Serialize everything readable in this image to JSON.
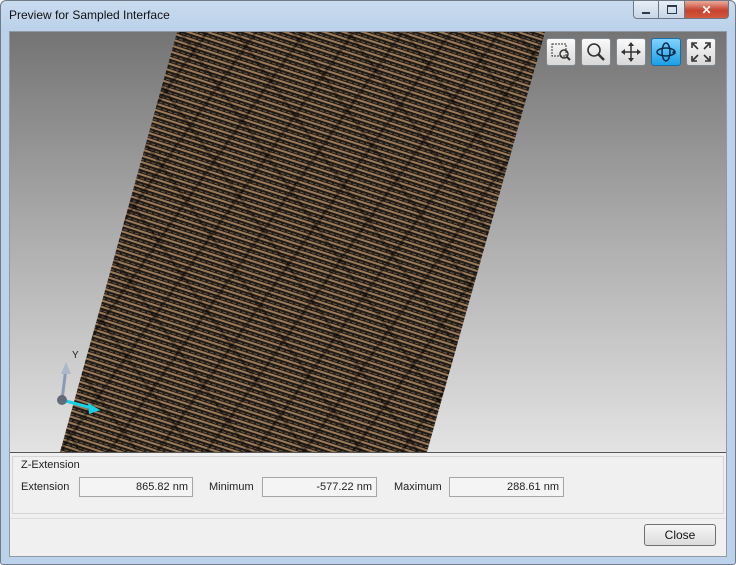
{
  "window": {
    "title": "Preview for Sampled Interface",
    "controls": [
      "minimize-icon",
      "maximize-icon",
      "close-icon"
    ]
  },
  "viewport": {
    "toolbar": [
      {
        "name": "zoom-window-tool",
        "icon": "zoom-rectangle-icon",
        "active": false
      },
      {
        "name": "zoom-tool",
        "icon": "magnifier-icon",
        "active": false
      },
      {
        "name": "pan-tool",
        "icon": "move-arrows-icon",
        "active": false
      },
      {
        "name": "rotate-tool",
        "icon": "rotate-3d-icon",
        "active": true
      },
      {
        "name": "fit-tool",
        "icon": "fit-all-icon",
        "active": false
      }
    ],
    "axis_label_y": "Y",
    "surface_color": "#8a6a4a"
  },
  "z_extension": {
    "group_title": "Z-Extension",
    "extension_label": "Extension",
    "extension_value": "865.82 nm",
    "minimum_label": "Minimum",
    "minimum_value": "-577.22 nm",
    "maximum_label": "Maximum",
    "maximum_value": "288.61 nm"
  },
  "footer": {
    "close_label": "Close"
  },
  "colors": {
    "active_tool": "#1aa0e8",
    "axis_arrow": "#19d0e6"
  }
}
